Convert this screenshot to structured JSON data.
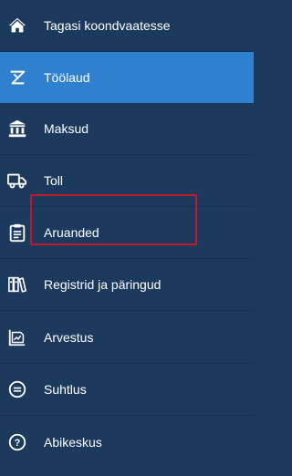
{
  "menu": {
    "items": [
      {
        "label": "Tagasi koondvaatesse",
        "icon": "home-icon"
      },
      {
        "label": "Töölaud",
        "icon": "dashboard-icon"
      },
      {
        "label": "Maksud",
        "icon": "bank-icon"
      },
      {
        "label": "Toll",
        "icon": "truck-icon"
      },
      {
        "label": "Aruanded",
        "icon": "clipboard-icon"
      },
      {
        "label": "Registrid ja päringud",
        "icon": "books-icon"
      },
      {
        "label": "Arvestus",
        "icon": "chart-icon"
      },
      {
        "label": "Suhtlus",
        "icon": "chat-icon"
      },
      {
        "label": "Abikeskus",
        "icon": "help-icon"
      }
    ],
    "active_index": 1,
    "highlighted_index": 5
  },
  "colors": {
    "background": "#1c3a5e",
    "active": "#2f81cf",
    "highlight_border": "#c4182a"
  }
}
